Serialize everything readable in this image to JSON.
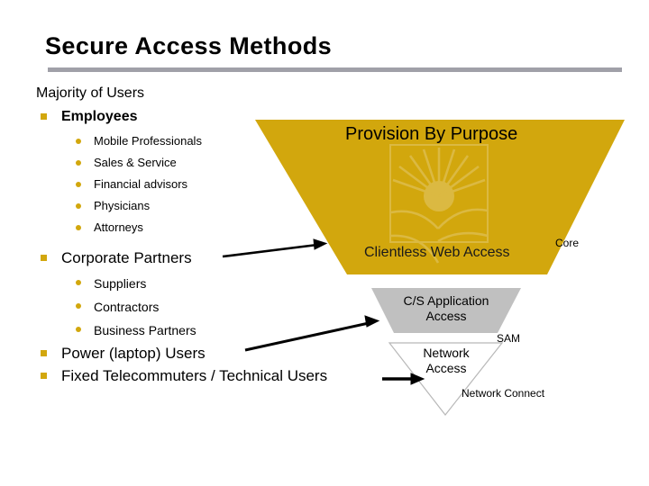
{
  "slide": {
    "title": "Secure Access Methods",
    "accent_gold": "#d2a70d",
    "rule_gray": "#a0a0a8",
    "tier_gray": "#c0c0c0",
    "background": "#ffffff"
  },
  "outline": {
    "heading": "Majority of Users",
    "items": [
      {
        "level": 1,
        "label": "Employees",
        "bold": true
      },
      {
        "level": 2,
        "label": "Mobile Professionals"
      },
      {
        "level": 2,
        "label": "Sales & Service"
      },
      {
        "level": 2,
        "label": "Financial advisors"
      },
      {
        "level": 2,
        "label": "Physicians"
      },
      {
        "level": 2,
        "label": "Attorneys"
      },
      {
        "level": 1,
        "label": "Corporate Partners"
      },
      {
        "level": 2,
        "label": "Suppliers"
      },
      {
        "level": 2,
        "label": "Contractors"
      },
      {
        "level": 2,
        "label": "Business Partners"
      },
      {
        "level": 1,
        "label": "Power (laptop) Users"
      },
      {
        "level": 1,
        "label": "Fixed Telecommuters / Technical Users"
      }
    ]
  },
  "funnel": {
    "heading": "Provision By Purpose",
    "tiers": [
      {
        "label": "Clientless Web Access",
        "product": "Core",
        "color": "#d2a70d"
      },
      {
        "label": "C/S Application Access",
        "product": "SAM",
        "color": "#c0c0c0"
      },
      {
        "label": "Network Access",
        "product": "Network Connect",
        "color": "#ffffff"
      }
    ],
    "watermark": "sunrise-logo"
  }
}
